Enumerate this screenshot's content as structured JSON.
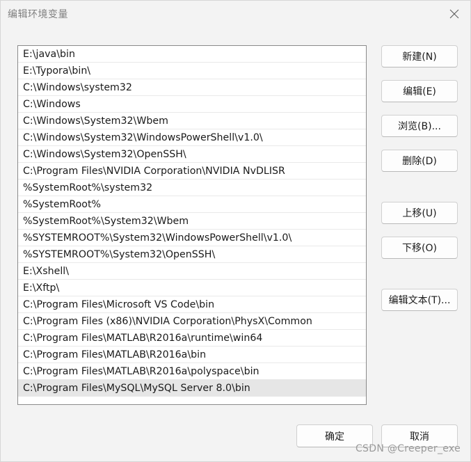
{
  "window": {
    "title": "编辑环境变量"
  },
  "path_list": [
    "E:\\java\\bin",
    "E:\\Typora\\bin\\",
    "C:\\Windows\\system32",
    "C:\\Windows",
    "C:\\Windows\\System32\\Wbem",
    "C:\\Windows\\System32\\WindowsPowerShell\\v1.0\\",
    "C:\\Windows\\System32\\OpenSSH\\",
    "C:\\Program Files\\NVIDIA Corporation\\NVIDIA NvDLISR",
    "%SystemRoot%\\system32",
    "%SystemRoot%",
    "%SystemRoot%\\System32\\Wbem",
    "%SYSTEMROOT%\\System32\\WindowsPowerShell\\v1.0\\",
    "%SYSTEMROOT%\\System32\\OpenSSH\\",
    "E:\\Xshell\\",
    "E:\\Xftp\\",
    "C:\\Program Files\\Microsoft VS Code\\bin",
    "C:\\Program Files (x86)\\NVIDIA Corporation\\PhysX\\Common",
    "C:\\Program Files\\MATLAB\\R2016a\\runtime\\win64",
    "C:\\Program Files\\MATLAB\\R2016a\\bin",
    "C:\\Program Files\\MATLAB\\R2016a\\polyspace\\bin",
    "C:\\Program Files\\MySQL\\MySQL Server 8.0\\bin"
  ],
  "selected_index": 20,
  "buttons": {
    "new": "新建(N)",
    "edit": "编辑(E)",
    "browse": "浏览(B)...",
    "delete": "删除(D)",
    "move_up": "上移(U)",
    "move_down": "下移(O)",
    "edit_text": "编辑文本(T)...",
    "ok": "确定",
    "cancel": "取消"
  },
  "watermark": "CSDN @Creeper_exe",
  "icons": {
    "close": "close-icon"
  }
}
